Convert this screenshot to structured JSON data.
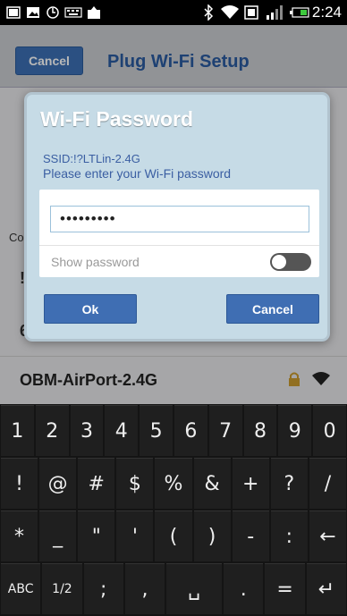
{
  "status_bar": {
    "time": "2:24",
    "left_icons": [
      "gallery-icon",
      "photo-icon",
      "sync-icon",
      "keyboard-icon",
      "upload-icon"
    ],
    "right_icons": [
      "bluetooth-icon",
      "wifi-icon",
      "nfc-icon",
      "signal-icon",
      "battery-icon"
    ]
  },
  "app": {
    "cancel_label": "Cancel",
    "title": "Plug Wi-Fi Setup",
    "list_stub_1": "Co",
    "list_stub_2": "!",
    "list_stub_3": "6",
    "network_name": "OBM-AirPort-2.4G"
  },
  "dialog": {
    "title": "Wi-Fi Password",
    "ssid_line": "SSID:!?LTLin-2.4G",
    "prompt": "Please enter your Wi-Fi password",
    "password_value": "•••••••••",
    "show_password_label": "Show password",
    "show_password_on": false,
    "ok_label": "Ok",
    "cancel_label": "Cancel"
  },
  "keyboard": {
    "row1": [
      "1",
      "2",
      "3",
      "4",
      "5",
      "6",
      "7",
      "8",
      "9",
      "0"
    ],
    "row2": [
      "!",
      "@",
      "#",
      "$",
      "%",
      "&",
      "+",
      "?",
      "/"
    ],
    "row3": [
      "*",
      "_",
      "\"",
      "'",
      "(",
      ")",
      "-",
      ":",
      "←"
    ],
    "row4": [
      "ABC",
      "1/2",
      ";",
      ",",
      "␣",
      ".",
      "=",
      "↵"
    ]
  },
  "colors": {
    "accent": "#3f6eb3",
    "dialog_bg": "#c6dbe6",
    "title_blue": "#2a5aa0"
  }
}
